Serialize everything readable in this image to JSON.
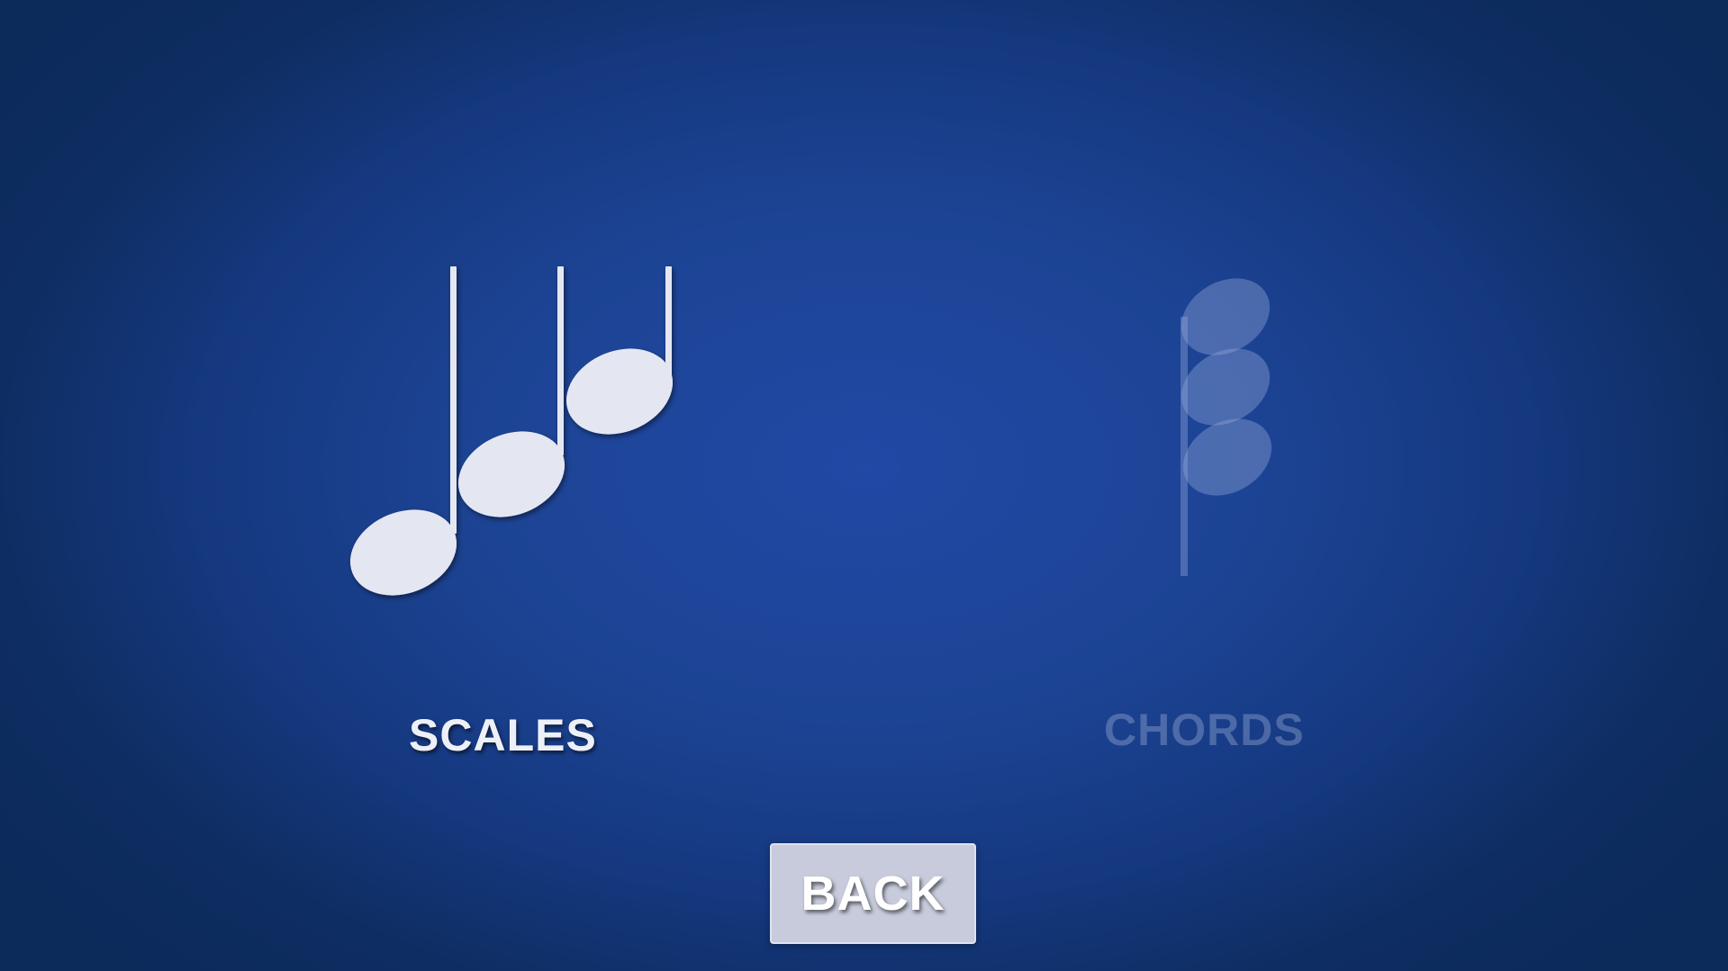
{
  "menu": {
    "options": [
      {
        "id": "scales",
        "label": "SCALES",
        "icon": "ascending-notes-icon",
        "enabled": true
      },
      {
        "id": "chords",
        "label": "CHORDS",
        "icon": "stacked-notes-chord-icon",
        "enabled": false
      }
    ]
  },
  "navigation": {
    "back_label": "BACK"
  },
  "colors": {
    "background_center": "#2149a5",
    "background_edge": "#0c2a5a",
    "note_fill": "#e4e7f2",
    "disabled_fill": "#8fa5d6",
    "button_fill": "#c7cbdb"
  }
}
